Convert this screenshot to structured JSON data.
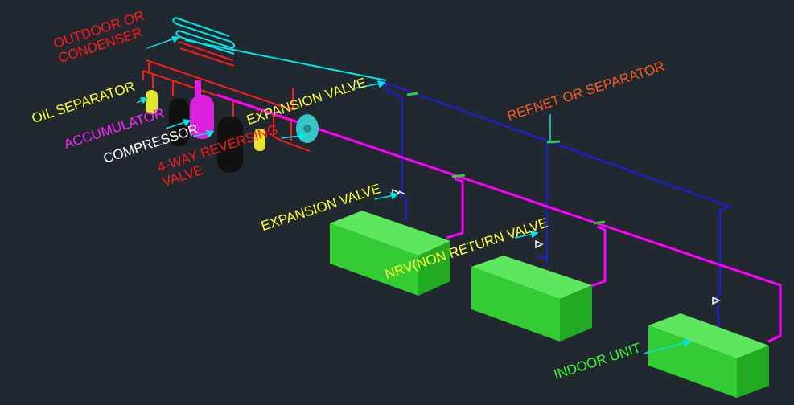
{
  "labels": {
    "outdoor": "OUTDOOR OR\nCONDENSER",
    "oil_separator": "OIL SEPARATOR",
    "accumulator": "ACCUMULATOR",
    "compressor": "COMPRESSOR",
    "four_way": "4-WAY REVERSING\nVALVE",
    "expansion_valve_top": "EXPANSION VALVE",
    "refnet": "REFNET OR SEPARATOR",
    "expansion_valve_bottom": "EXPANSION VALVE",
    "nrv": "NRV(NON RETURN VALVE",
    "indoor_unit": "INDOOR UNIT"
  },
  "colors": {
    "background": "#212830",
    "blue_line": "#1c1ce6",
    "magenta_line": "#ff00ff",
    "cyan_line": "#00e5e5",
    "red_line": "#ff1a1a",
    "green_unit": "#33cc33",
    "yellow": "#ffff33",
    "white": "#ffffff",
    "orange": "#ff5a1a"
  }
}
